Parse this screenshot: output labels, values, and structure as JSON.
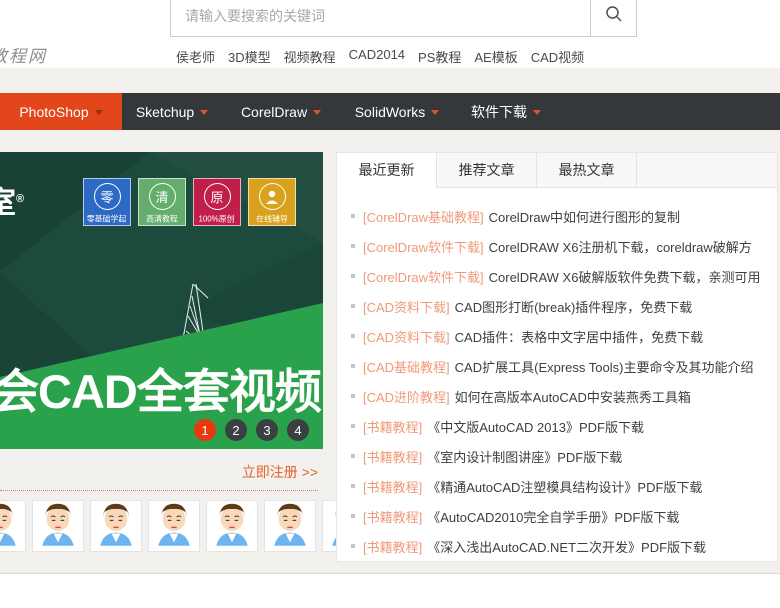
{
  "header": {
    "search_placeholder": "请输入要搜索的关键词",
    "logo_text": "教程网",
    "quick_links": [
      "侯老师",
      "3D模型",
      "视频教程",
      "CAD2014",
      "PS教程",
      "AE模板",
      "CAD视频"
    ]
  },
  "main_nav": {
    "items": [
      {
        "label": "PhotoShop",
        "active": true
      },
      {
        "label": "Sketchup",
        "active": false
      },
      {
        "label": "CorelDraw",
        "active": false
      },
      {
        "label": "SolidWorks",
        "active": false
      },
      {
        "label": "软件下载",
        "active": false
      }
    ]
  },
  "banner": {
    "logo_fragment": "室",
    "logo_reg": "®",
    "badges": [
      {
        "char": "零",
        "label": "零基础学起",
        "color": "#2d6ac6",
        "icon": "circle-char"
      },
      {
        "char": "清",
        "label": "高清教程",
        "color": "#64ad6c",
        "icon": "circle-char"
      },
      {
        "char": "原",
        "label": "100%原创",
        "color": "#bf1f48",
        "icon": "circle-char"
      },
      {
        "char": "",
        "label": "在线辅导",
        "color": "#daa11c",
        "icon": "person"
      }
    ],
    "headline": "会CAD全套视频",
    "pagination": [
      "1",
      "2",
      "3",
      "4"
    ],
    "active_page": "1"
  },
  "register": {
    "label": "立即注册 >>"
  },
  "avatars": {
    "count": 7
  },
  "articles_panel": {
    "tabs": [
      {
        "label": "最近更新",
        "active": true
      },
      {
        "label": "推荐文章",
        "active": false
      },
      {
        "label": "最热文章",
        "active": false
      }
    ],
    "items": [
      {
        "category": "[CorelDraw基础教程]",
        "title": "CorelDraw中如何进行图形的复制"
      },
      {
        "category": "[CorelDraw软件下载]",
        "title": "CorelDRAW X6注册机下载，coreldraw破解方"
      },
      {
        "category": "[CorelDraw软件下载]",
        "title": "CorelDRAW X6破解版软件免费下载，亲测可用"
      },
      {
        "category": "[CAD资料下载]",
        "title": "CAD图形打断(break)插件程序，免费下载"
      },
      {
        "category": "[CAD资料下载]",
        "title": "CAD插件：表格中文字居中插件，免费下载"
      },
      {
        "category": "[CAD基础教程]",
        "title": "CAD扩展工具(Express Tools)主要命令及其功能介绍"
      },
      {
        "category": "[CAD进阶教程]",
        "title": "如何在高版本AutoCAD中安装燕秀工具箱"
      },
      {
        "category": "[书籍教程]",
        "title": "《中文版AutoCAD 2013》PDF版下载"
      },
      {
        "category": "[书籍教程]",
        "title": "《室内设计制图讲座》PDF版下载"
      },
      {
        "category": "[书籍教程]",
        "title": "《精通AutoCAD注塑模具结构设计》PDF版下载"
      },
      {
        "category": "[书籍教程]",
        "title": "《AutoCAD2010完全自学手册》PDF版下载"
      },
      {
        "category": "[书籍教程]",
        "title": "《深入浅出AutoCAD.NET二次开发》PDF版下载"
      }
    ]
  }
}
